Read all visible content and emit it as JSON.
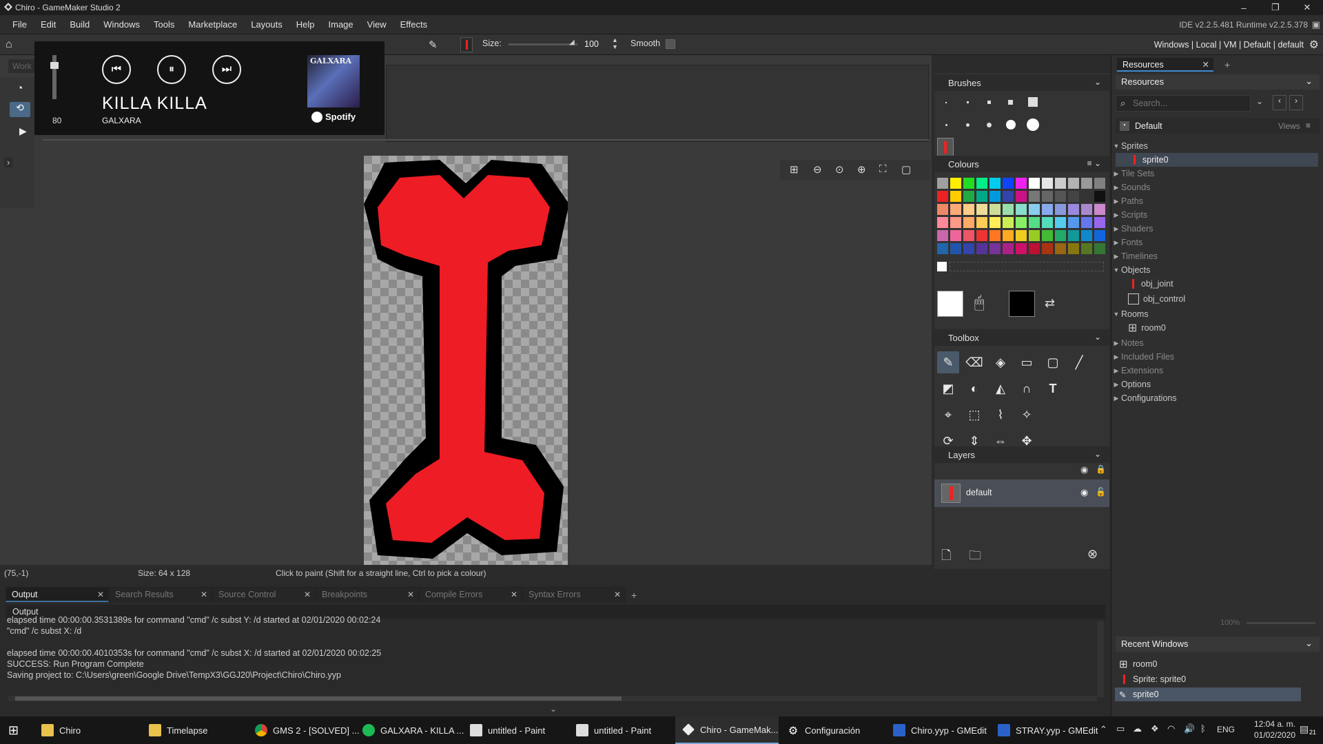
{
  "titlebar": {
    "title": "Chiro - GameMaker Studio 2"
  },
  "menu": {
    "items": [
      "File",
      "Edit",
      "Build",
      "Windows",
      "Tools",
      "Marketplace",
      "Layouts",
      "Help",
      "Image",
      "View",
      "Effects"
    ],
    "version": "IDE v2.2.5.481  Runtime v2.2.5.378"
  },
  "toolbar": {
    "size_label": "Size:",
    "size_value": "100",
    "smooth_label": "Smooth",
    "target": "Windows  |  Local  |  VM  |  Default  |  default"
  },
  "left_tabs": {
    "workspace": "Work"
  },
  "spotify": {
    "volume": "80",
    "track": "KILLA KILLA",
    "artist": "GALXARA",
    "brand": "Spotify",
    "cover_text": "GALXARA"
  },
  "brushes": {
    "title": "Brushes"
  },
  "colours": {
    "title": "Colours",
    "palette": [
      [
        "#a0a0a0",
        "#ffee00",
        "#22dd22",
        "#00ee88",
        "#00ccee",
        "#1144ff",
        "#ee22ee",
        "#ffffff",
        "#e6e6e6",
        "#cccccc",
        "#b3b3b3",
        "#999999",
        "#808080"
      ],
      [
        "#ee2222",
        "#ffcc00",
        "#22aa44",
        "#00aa88",
        "#0099dd",
        "#3344aa",
        "#cc1188",
        "#777777",
        "#666666",
        "#555555",
        "#444444",
        "#333333",
        "#111111"
      ],
      [
        "#ee8866",
        "#ffaa77",
        "#ffcc88",
        "#eedd99",
        "#ccdd99",
        "#99ddaa",
        "#88ddcc",
        "#88ccee",
        "#88aaee",
        "#8899dd",
        "#9988dd",
        "#aa88cc",
        "#cc88cc"
      ],
      [
        "#ff8899",
        "#ff9988",
        "#ffaa66",
        "#ffcc55",
        "#ffee55",
        "#ccee55",
        "#88ee66",
        "#55dd88",
        "#55ddbb",
        "#55ccee",
        "#5599ee",
        "#6677ee",
        "#9966ee"
      ],
      [
        "#cc66aa",
        "#ee6699",
        "#ee5566",
        "#ee3333",
        "#ff7722",
        "#ffaa22",
        "#eecc22",
        "#99cc22",
        "#44bb33",
        "#22aa66",
        "#119999",
        "#1188cc",
        "#1166dd"
      ],
      [
        "#2266aa",
        "#2255aa",
        "#3344aa",
        "#553399",
        "#773399",
        "#aa2288",
        "#cc1166",
        "#bb1133",
        "#aa3311",
        "#996611",
        "#887711",
        "#557722",
        "#337733"
      ]
    ],
    "primary": "#ffffff",
    "secondary": "#000000"
  },
  "toolbox": {
    "title": "Toolbox"
  },
  "layers": {
    "title": "Layers",
    "items": [
      "default"
    ]
  },
  "resources": {
    "tab": "Resources",
    "header": "Resources",
    "search_placeholder": "Search...",
    "group": "Default",
    "views": "Views",
    "tree": [
      {
        "label": "Sprites",
        "open": true,
        "children": [
          "sprite0"
        ]
      },
      {
        "label": "Tile Sets",
        "dim": true
      },
      {
        "label": "Sounds",
        "dim": true
      },
      {
        "label": "Paths",
        "dim": true
      },
      {
        "label": "Scripts",
        "dim": true
      },
      {
        "label": "Shaders",
        "dim": true
      },
      {
        "label": "Fonts",
        "dim": true
      },
      {
        "label": "Timelines",
        "dim": true
      },
      {
        "label": "Objects",
        "open": true,
        "children": [
          "obj_joint",
          "obj_control"
        ]
      },
      {
        "label": "Rooms",
        "open": true,
        "children": [
          "room0"
        ]
      },
      {
        "label": "Notes",
        "dim": true
      },
      {
        "label": "Included Files",
        "dim": true
      },
      {
        "label": "Extensions",
        "dim": true
      },
      {
        "label": "Options"
      },
      {
        "label": "Configurations"
      }
    ],
    "zoom": "100%"
  },
  "recent": {
    "title": "Recent Windows",
    "items": [
      "room0",
      "Sprite: sprite0",
      "sprite0"
    ]
  },
  "status": {
    "coords": "(75,-1)",
    "size": "Size: 64 x 128",
    "hint": "Click to paint (Shift for a straight line, Ctrl to pick a colour)"
  },
  "output": {
    "tabs": [
      "Output",
      "Search Results",
      "Source Control",
      "Breakpoints",
      "Compile Errors",
      "Syntax Errors"
    ],
    "header": "Output",
    "lines": [
      "elapsed time 00:00:00.3531389s for command \"cmd\" /c subst Y: /d started at 02/01/2020 00:02:24",
      "\"cmd\"  /c subst X: /d",
      "",
      "elapsed time 00:00:00.4010353s for command \"cmd\" /c subst X: /d started at 02/01/2020 00:02:25",
      "SUCCESS: Run Program Complete",
      "Saving project to: C:\\Users\\green\\Google Drive\\TempX3\\GGJ20\\Project\\Chiro\\Chiro.yyp"
    ]
  },
  "taskbar": {
    "items": [
      "Chiro",
      "Timelapse",
      "GMS 2 - [SOLVED] ...",
      "GALXARA - KILLA ...",
      "untitled - Paint",
      "untitled - Paint",
      "Chiro - GameMak...",
      "Configuración",
      "Chiro.yyp - GMEdit",
      "STRAY.yyp - GMEdit"
    ],
    "lang": "ENG",
    "time": "12:04 a. m.",
    "date": "01/02/2020",
    "badge": "21"
  }
}
